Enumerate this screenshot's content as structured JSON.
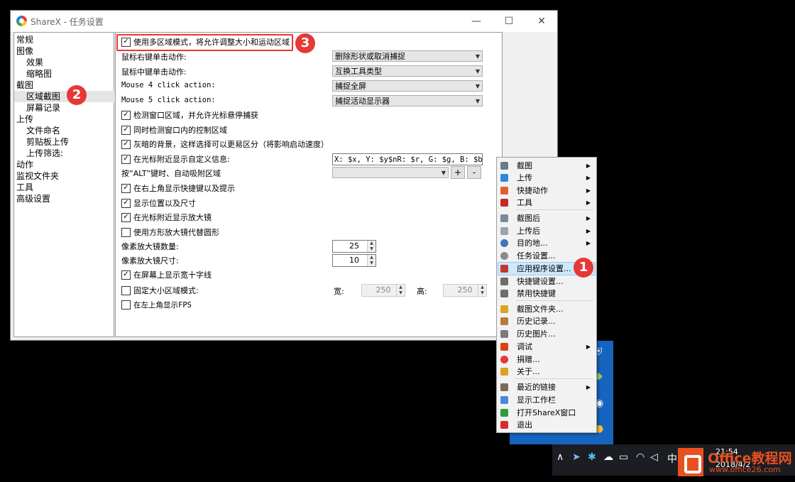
{
  "window": {
    "title": "ShareX - 任务设置",
    "minimize": "—",
    "maximize": "☐",
    "close": "✕"
  },
  "tree": [
    "常规",
    "图像",
    "效果",
    "缩略图",
    "截图",
    "区域截图",
    "屏幕记录",
    "上传",
    "文件命名",
    "剪贴板上传",
    "上传筛选:",
    "动作",
    "监视文件夹",
    "工具",
    "高级设置"
  ],
  "settings": {
    "multi_region": "使用多区域模式，将允许调整大小和运动区域",
    "right_click_label": "鼠标右键单击动作:",
    "right_click_value": "删除形状或取消捕捉",
    "middle_click_label": "鼠标中键单击动作:",
    "middle_click_value": "互换工具类型",
    "mouse4_label": "Mouse 4 click action:",
    "mouse4_value": "捕捉全屏",
    "mouse5_label": "Mouse 5 click action:",
    "mouse5_value": "捕捉活动显示器",
    "detect_windows": "检测窗口区域，并允许光标悬停捕获",
    "detect_controls": "同时检测窗口内的控制区域",
    "dim_background": "灰暗的背景，这样选择可以更易区分（将影响启动速度）",
    "custom_info": "在光标附近显示自定义信息:",
    "custom_info_value": "X: $x, Y: $y$nR: $r, G: $g, B: $b$n",
    "snap_label": "按”ALT”键时、自动吸附区域",
    "snap_add": "+",
    "snap_remove": "-",
    "show_hotkeys": "在右上角显示快捷键以及提示",
    "show_position": "显示位置以及尺寸",
    "show_magnifier": "在光标附近显示放大镜",
    "square_magnifier": "使用方形放大镜代替圆形",
    "magnifier_count_label": "像素放大镜数量:",
    "magnifier_count": "25",
    "magnifier_size_label": "像素放大镜尺寸:",
    "magnifier_size": "10",
    "crosshair": "在屏幕上显示宽十字线",
    "fixed_size": "固定大小区域模式:",
    "width_label": "宽:",
    "width_value": "250",
    "height_label": "高:",
    "height_value": "250",
    "show_fps": "在左上角显示FPS"
  },
  "menu": [
    {
      "label": "截图",
      "submenu": true,
      "icon": "capture-icon",
      "color": "#6b7b8c"
    },
    {
      "label": "上传",
      "submenu": true,
      "icon": "upload-arrow-icon",
      "color": "#2f88d8"
    },
    {
      "label": "快捷动作",
      "submenu": true,
      "icon": "grid-icon",
      "color": "#e06030"
    },
    {
      "label": "工具",
      "submenu": true,
      "icon": "toolbox-icon",
      "color": "#c62828"
    },
    {
      "label": "截图后",
      "submenu": true,
      "icon": "after-capture-icon",
      "color": "#7a8a9a"
    },
    {
      "label": "上传后",
      "submenu": true,
      "icon": "cloud-icon",
      "color": "#9aa4ae"
    },
    {
      "label": "目的地...",
      "submenu": true,
      "icon": "globe-icon",
      "color": "#3a78b8"
    },
    {
      "label": "任务设置...",
      "submenu": false,
      "icon": "gear-icon",
      "color": "#8a8a8a"
    },
    {
      "label": "应用程序设置...",
      "submenu": false,
      "icon": "wrench-icon",
      "color": "#c0392b"
    },
    {
      "label": "快捷键设置...",
      "submenu": false,
      "icon": "keyboard-icon",
      "color": "#6d6d6d"
    },
    {
      "label": "禁用快捷键",
      "submenu": false,
      "icon": "keyboard-off-icon",
      "color": "#6d6d6d"
    },
    {
      "label": "截图文件夹...",
      "submenu": false,
      "icon": "folder-icon",
      "color": "#d9a520"
    },
    {
      "label": "历史记录...",
      "submenu": false,
      "icon": "history-icon",
      "color": "#b87a3a"
    },
    {
      "label": "历史图片...",
      "submenu": false,
      "icon": "image-history-icon",
      "color": "#7a7a7a"
    },
    {
      "label": "调试",
      "submenu": true,
      "icon": "debug-icon",
      "color": "#d84315"
    },
    {
      "label": "捐赠...",
      "submenu": false,
      "icon": "heart-icon",
      "color": "#e53935"
    },
    {
      "label": "关于...",
      "submenu": false,
      "icon": "crown-icon",
      "color": "#e0a020"
    },
    {
      "label": "最近的链接",
      "submenu": true,
      "icon": "clipboard-icon",
      "color": "#7a6a5a"
    },
    {
      "label": "显示工作栏",
      "submenu": false,
      "icon": "taskbar-icon",
      "color": "#4a8ad8"
    },
    {
      "label": "打开ShareX窗口",
      "submenu": false,
      "icon": "check-icon",
      "color": "#2e9d3a"
    },
    {
      "label": "退出",
      "submenu": false,
      "icon": "exit-icon",
      "color": "#d32f2f"
    }
  ],
  "badges": {
    "one": "1",
    "two": "2",
    "three": "3"
  },
  "taskbar": {
    "caret": "∧",
    "ime": "中",
    "time": "21:54",
    "date": "2018/4/2"
  },
  "logo": {
    "name": "Office教程网",
    "url": "www.office26.com"
  }
}
